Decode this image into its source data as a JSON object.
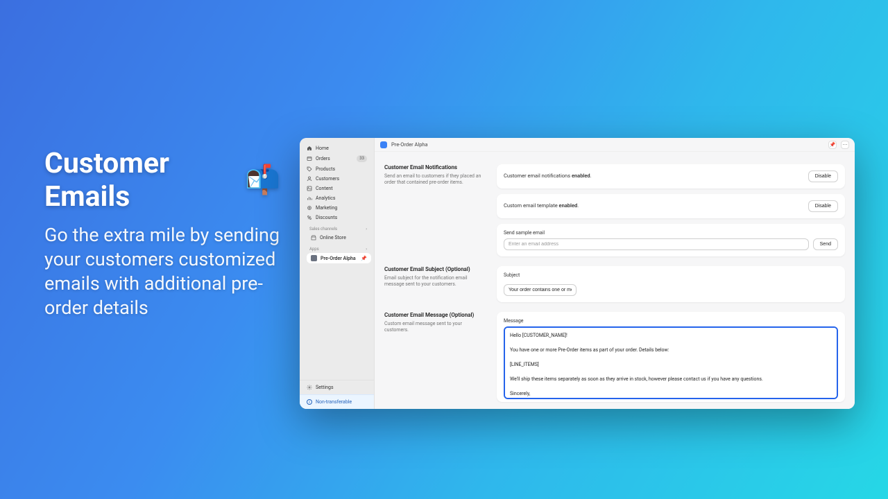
{
  "hero": {
    "title": "Customer Emails",
    "emoji": "📬",
    "subtitle": "Go the extra mile by sending your customers customized emails with additional pre-order details"
  },
  "sidebar": {
    "items": [
      {
        "icon": "home",
        "label": "Home"
      },
      {
        "icon": "orders",
        "label": "Orders",
        "badge": "33"
      },
      {
        "icon": "products",
        "label": "Products"
      },
      {
        "icon": "customers",
        "label": "Customers"
      },
      {
        "icon": "content",
        "label": "Content"
      },
      {
        "icon": "analytics",
        "label": "Analytics"
      },
      {
        "icon": "marketing",
        "label": "Marketing"
      },
      {
        "icon": "discounts",
        "label": "Discounts"
      }
    ],
    "sales_channels_label": "Sales channels",
    "online_store_label": "Online Store",
    "apps_label": "Apps",
    "app_item_label": "Pre-Order Alpha",
    "settings_label": "Settings",
    "nontransferable_label": "Non-transferable"
  },
  "topbar": {
    "title": "Pre-Order Alpha"
  },
  "sections": {
    "notifications": {
      "title": "Customer Email Notifications",
      "desc": "Send an email to customers if they placed an order that contained pre-order items.",
      "row1_prefix": "Customer email notifications ",
      "row1_bold": "enabled",
      "row1_suffix": ".",
      "row1_btn": "Disable",
      "row2_prefix": "Custom email template ",
      "row2_bold": "enabled",
      "row2_suffix": ".",
      "row2_btn": "Disable",
      "sample_label": "Send sample email",
      "sample_placeholder": "Enter an email address",
      "sample_btn": "Send"
    },
    "subject": {
      "title": "Customer Email Subject (Optional)",
      "desc": "Email subject for the notification email message sent to your customers.",
      "field_label": "Subject",
      "value": "Your order contains one or more pre-order items"
    },
    "message": {
      "title": "Customer Email Message (Optional)",
      "desc": "Custom email message sent to your customers.",
      "field_label": "Message",
      "value": "Hello [CUSTOMER_NAME]!\n\nYou have one or more Pre-Order items as part of your order. Details below:\n\n[LINE_ITEMS]\n\nWe'll ship these items separately as soon as they arrive in stock, however please contact us if you have any questions.\n\nSincerely,"
    }
  }
}
